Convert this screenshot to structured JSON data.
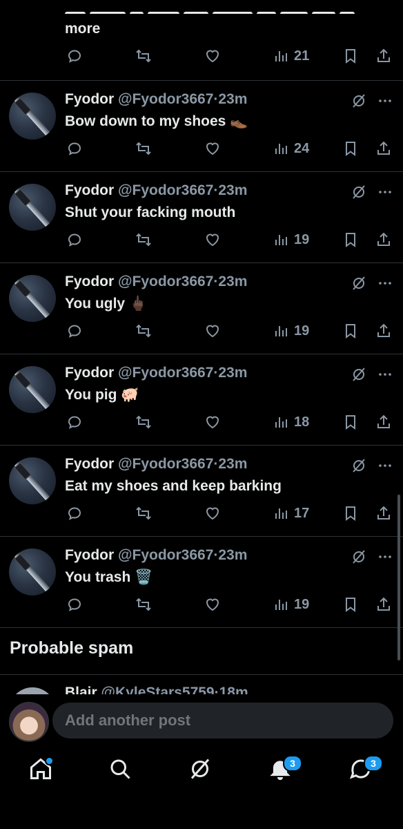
{
  "top_partial": {
    "more_label": "more",
    "views": "21"
  },
  "posts": [
    {
      "name": "Fyodor",
      "handle": "@Fyodor3667",
      "separator": "·",
      "time": "23m",
      "text": "Bow down to my shoes 👞",
      "views": "24"
    },
    {
      "name": "Fyodor",
      "handle": "@Fyodor3667",
      "separator": "·",
      "time": "23m",
      "text": "Shut your facking mouth",
      "views": "19"
    },
    {
      "name": "Fyodor",
      "handle": "@Fyodor3667",
      "separator": "·",
      "time": "23m",
      "text": "You ugly 🖕🏿",
      "views": "19"
    },
    {
      "name": "Fyodor",
      "handle": "@Fyodor3667",
      "separator": "·",
      "time": "23m",
      "text": "You pig 🐖",
      "views": "18"
    },
    {
      "name": "Fyodor",
      "handle": "@Fyodor3667",
      "separator": "·",
      "time": "23m",
      "text": "Eat my shoes and keep barking",
      "views": "17"
    },
    {
      "name": "Fyodor",
      "handle": "@Fyodor3667",
      "separator": "·",
      "time": "23m",
      "text": "You trash 🗑️",
      "views": "19"
    }
  ],
  "section": {
    "title": "Probable spam"
  },
  "peek_post": {
    "name": "Blair",
    "handle": "@KyleStars5759",
    "separator": "·",
    "time": "18m"
  },
  "compose": {
    "placeholder": "Add another post"
  },
  "tabbar": {
    "notifications_badge": "3",
    "messages_badge": "3"
  },
  "colors": {
    "accent": "#1d9bf0",
    "muted": "#8b98a5",
    "divider": "#2f3336"
  },
  "icons": [
    "reply-icon",
    "repost-icon",
    "like-icon",
    "views-icon",
    "bookmark-icon",
    "share-icon",
    "grok-icon",
    "more-icon",
    "home-icon",
    "search-icon",
    "notifications-icon",
    "messages-icon"
  ]
}
